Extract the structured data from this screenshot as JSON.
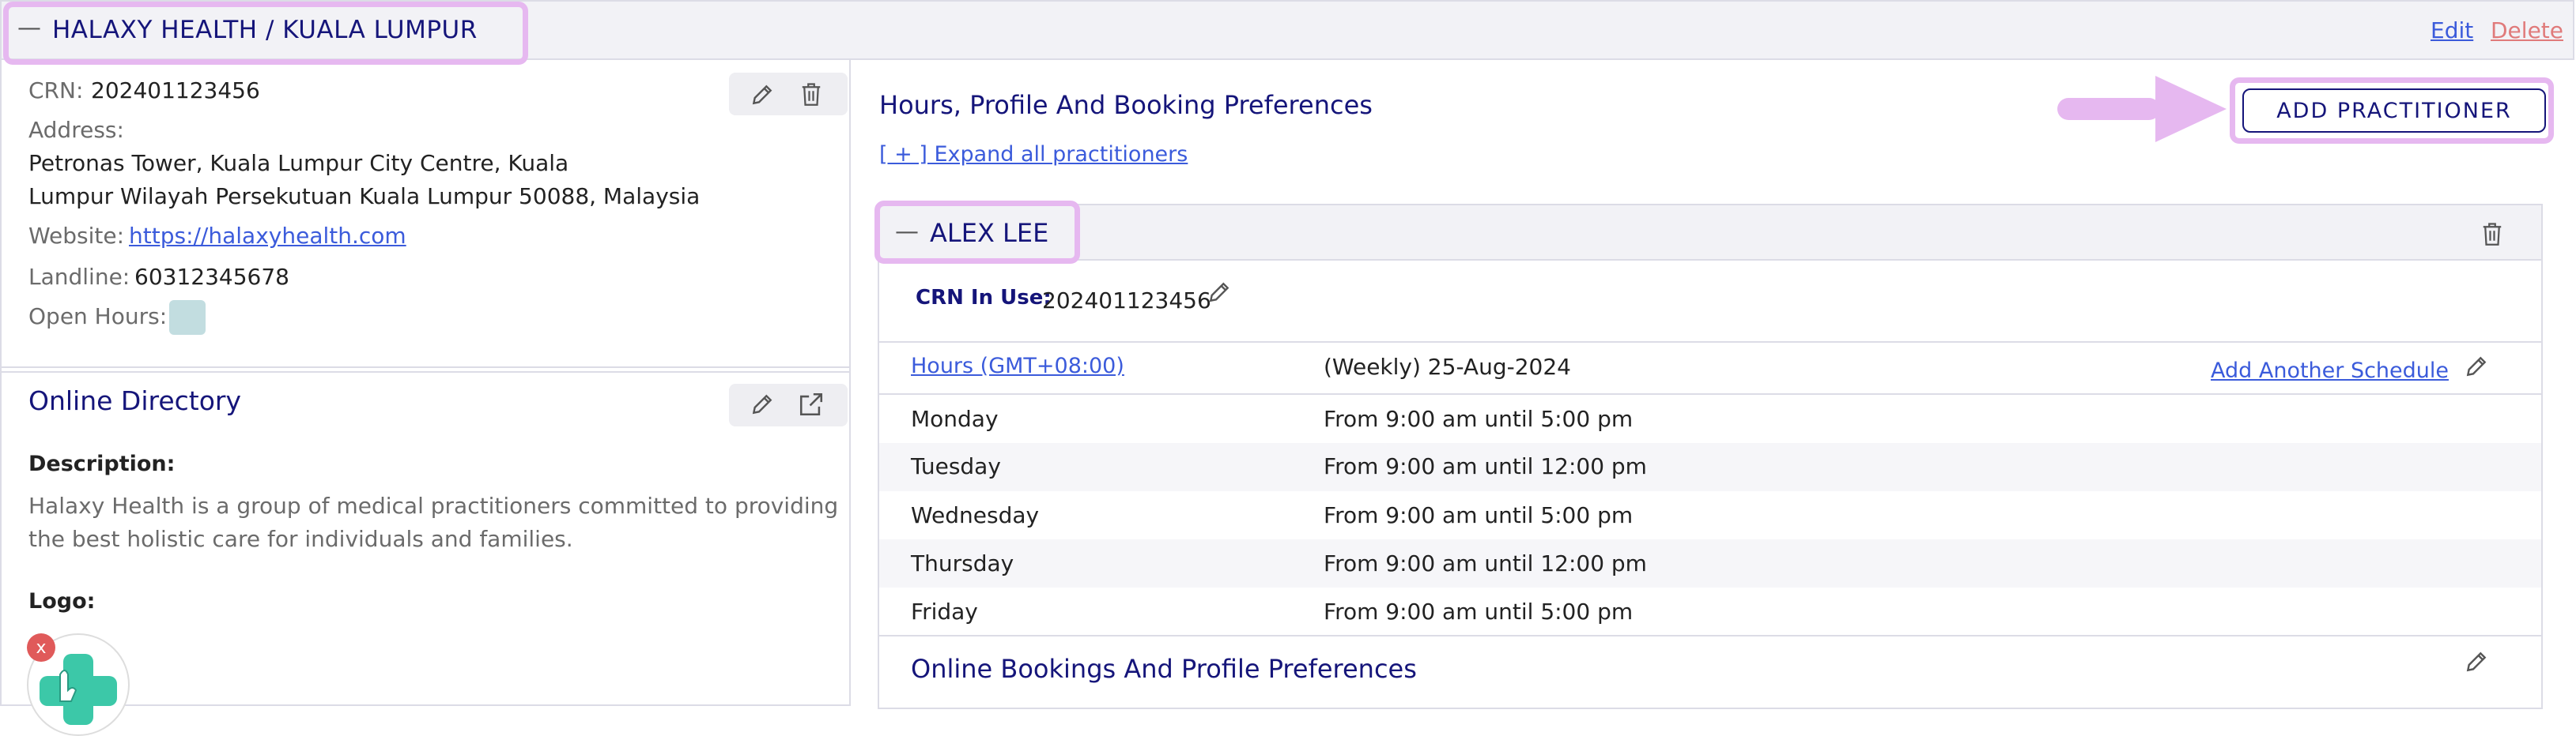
{
  "header": {
    "collapse_glyph": "—",
    "title": "HALAXY HEALTH / KUALA LUMPUR",
    "edit_label": "Edit",
    "delete_label": "Delete"
  },
  "clinic": {
    "crn_label": "CRN:",
    "crn_value": "202401123456",
    "address_label": "Address:",
    "address_line1": "Petronas Tower, Kuala Lumpur City Centre, Kuala",
    "address_line2": "Lumpur Wilayah Persekutuan Kuala Lumpur 50088, Malaysia",
    "website_label": "Website:",
    "website_value": "https://halaxyhealth.com",
    "landline_label": "Landline:",
    "landline_value": "60312345678",
    "open_hours_label": "Open Hours:",
    "open_hours_swatch_color": "#c2dde0"
  },
  "directory": {
    "title": "Online Directory",
    "description_label": "Description:",
    "description_line1": "Halaxy Health is a group of medical practitioners committed to providing",
    "description_line2": "the best holistic care for individuals and families.",
    "logo_label": "Logo:",
    "remove_logo_glyph": "x"
  },
  "main": {
    "section_title": "Hours, Profile And Booking Preferences",
    "expand_all_label": "[ + ] Expand all practitioners",
    "add_practitioner_label": "ADD PRACTITIONER"
  },
  "practitioner": {
    "collapse_glyph": "—",
    "name": "ALEX LEE",
    "crn_in_use_label": "CRN In Use:",
    "crn_in_use_value": "202401123456",
    "hours_link": "Hours (GMT+08:00)",
    "schedule_label": "(Weekly) 25-Aug-2024",
    "add_schedule_label": "Add Another Schedule",
    "schedule": [
      {
        "day": "Monday",
        "hours": "From 9:00 am until 5:00 pm"
      },
      {
        "day": "Tuesday",
        "hours": "From 9:00 am until 12:00 pm"
      },
      {
        "day": "Wednesday",
        "hours": "From 9:00 am until 5:00 pm"
      },
      {
        "day": "Thursday",
        "hours": "From 9:00 am until 12:00 pm"
      },
      {
        "day": "Friday",
        "hours": "From 9:00 am until 5:00 pm"
      }
    ],
    "bookings_title": "Online Bookings And Profile Preferences"
  },
  "colors": {
    "navy": "#15157a",
    "link_blue": "#3b5bdb",
    "delete_red": "#e07a7a",
    "highlight": "#e6b8f0",
    "logo_green": "#3cc8a8",
    "remove_red": "#e05a5a"
  },
  "icons": [
    "minus-icon",
    "pencil-icon",
    "trash-icon",
    "external-link-icon",
    "arrow-right-icon",
    "close-icon",
    "logo-hand-cross"
  ]
}
